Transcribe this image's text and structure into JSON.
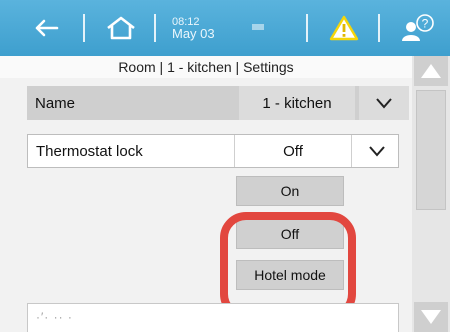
{
  "topbar": {
    "time": "08:12",
    "date": "May 03",
    "icons": [
      "back-arrow-icon",
      "home-icon",
      "warning-icon",
      "user-help-icon"
    ],
    "warning_color": "#f5d60a",
    "accent_color": "#48a7d4"
  },
  "breadcrumb": "Room | 1 - kitchen | Settings",
  "rows": {
    "name": {
      "label": "Name",
      "value": "1 - kitchen"
    },
    "thermostat_lock": {
      "label": "Thermostat lock",
      "value": "Off"
    }
  },
  "options": [
    "On",
    "Off",
    "Hotel mode"
  ],
  "highlight_color": "#e2473f"
}
